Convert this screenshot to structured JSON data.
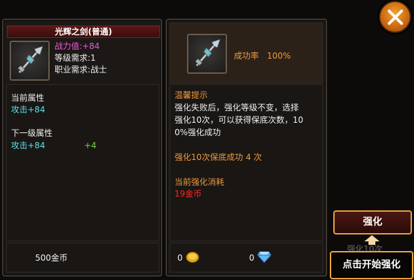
{
  "item": {
    "name": "光辉之剑(普通)",
    "power": "战力值:+84",
    "level_req": "等级需求:1",
    "class_req": "职业需求:战士"
  },
  "current_attr": {
    "label": "当前属性",
    "value": "攻击+84"
  },
  "next_attr": {
    "label": "下一级属性",
    "value": "攻击+84",
    "bonus": "+4"
  },
  "left_footer": {
    "cost": "500金币"
  },
  "right_panel": {
    "success_label": "成功率",
    "success_value": "100%",
    "tip_title": "温馨提示",
    "tip_lines": [
      "强化失败后，强化等级不变，选择",
      "强化10次，可以获得保底次数，10",
      "0%强化成功"
    ],
    "guarantee": "强化10次保底成功 4 次",
    "cost_title": "当前强化消耗",
    "cost_value": "19金币",
    "gold_count": "0",
    "diamond_count": "0"
  },
  "buttons": {
    "enhance": "强化",
    "enhance_ten": "强化10次",
    "hint": "点击开始强化"
  },
  "colors": {
    "cyan": "#5ce0ee",
    "green": "#7ed24a",
    "magenta": "#e95cd8",
    "orange": "#ef9a3e",
    "red": "#ff2a1e",
    "gold_border": "#f0a53a"
  },
  "icons": {
    "item": "halberd-icon",
    "close": "close-icon",
    "gold": "gold-coin-icon",
    "diamond": "diamond-icon",
    "arrow": "arrow-up-icon"
  }
}
